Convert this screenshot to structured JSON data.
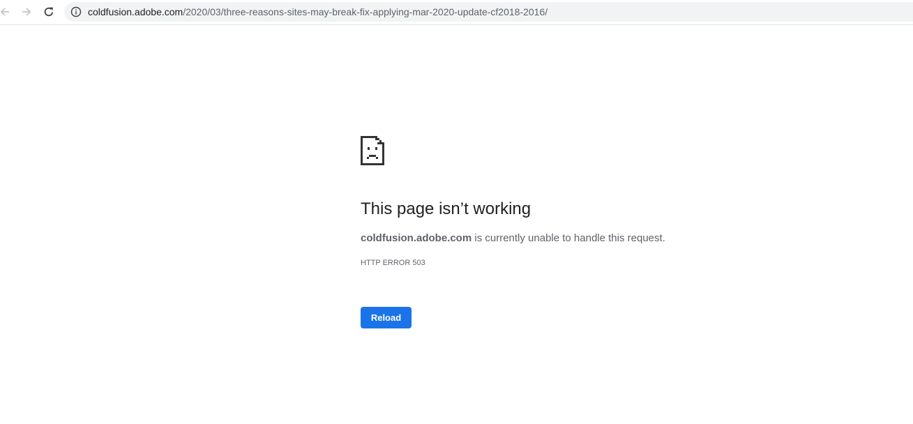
{
  "browser": {
    "url_host": "coldfusion.adobe.com",
    "url_path": "/2020/03/three-reasons-sites-may-break-fix-applying-mar-2020-update-cf2018-2016/",
    "icons": {
      "back": "arrow-left-icon",
      "forward": "arrow-right-icon",
      "reload": "reload-icon",
      "site_info": "info-icon"
    }
  },
  "error_page": {
    "icon": "sad-document-icon",
    "headline": "This page isn’t working",
    "host": "coldfusion.adobe.com",
    "message_suffix": " is currently unable to handle this request.",
    "error_code": "HTTP ERROR 503",
    "reload_label": "Reload"
  },
  "colors": {
    "accent": "#1a73e8",
    "headline": "#202124",
    "body_text": "#5f6368",
    "omnibox_bg": "#f1f3f4"
  }
}
